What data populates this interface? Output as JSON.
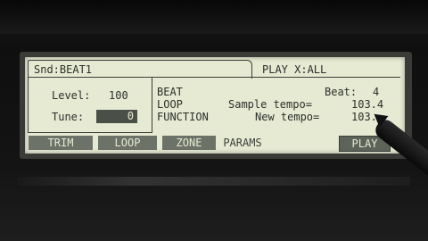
{
  "tab": {
    "label": "Snd:BEAT1"
  },
  "play_mode": "PLAY X:ALL",
  "left": {
    "level_label": "Level:",
    "level_value": "100",
    "tune_label": "Tune:",
    "tune_value": "0"
  },
  "menu": [
    "BEAT",
    "LOOP",
    "FUNCTION"
  ],
  "beat": {
    "label": "Beat:",
    "value": "4"
  },
  "sample_tempo": {
    "label": "Sample tempo=",
    "value": "103.4"
  },
  "new_tempo": {
    "label": "New tempo=",
    "value": "103."
  },
  "softkeys": {
    "trim": "TRIM",
    "loop": "LOOP",
    "zone": "ZONE",
    "params": "PARAMS",
    "play": "PLAY"
  },
  "colors": {
    "lcd_bg": "#e6ead3",
    "lcd_text": "#2b2f2a",
    "softkey_bg": "#6d7268"
  }
}
